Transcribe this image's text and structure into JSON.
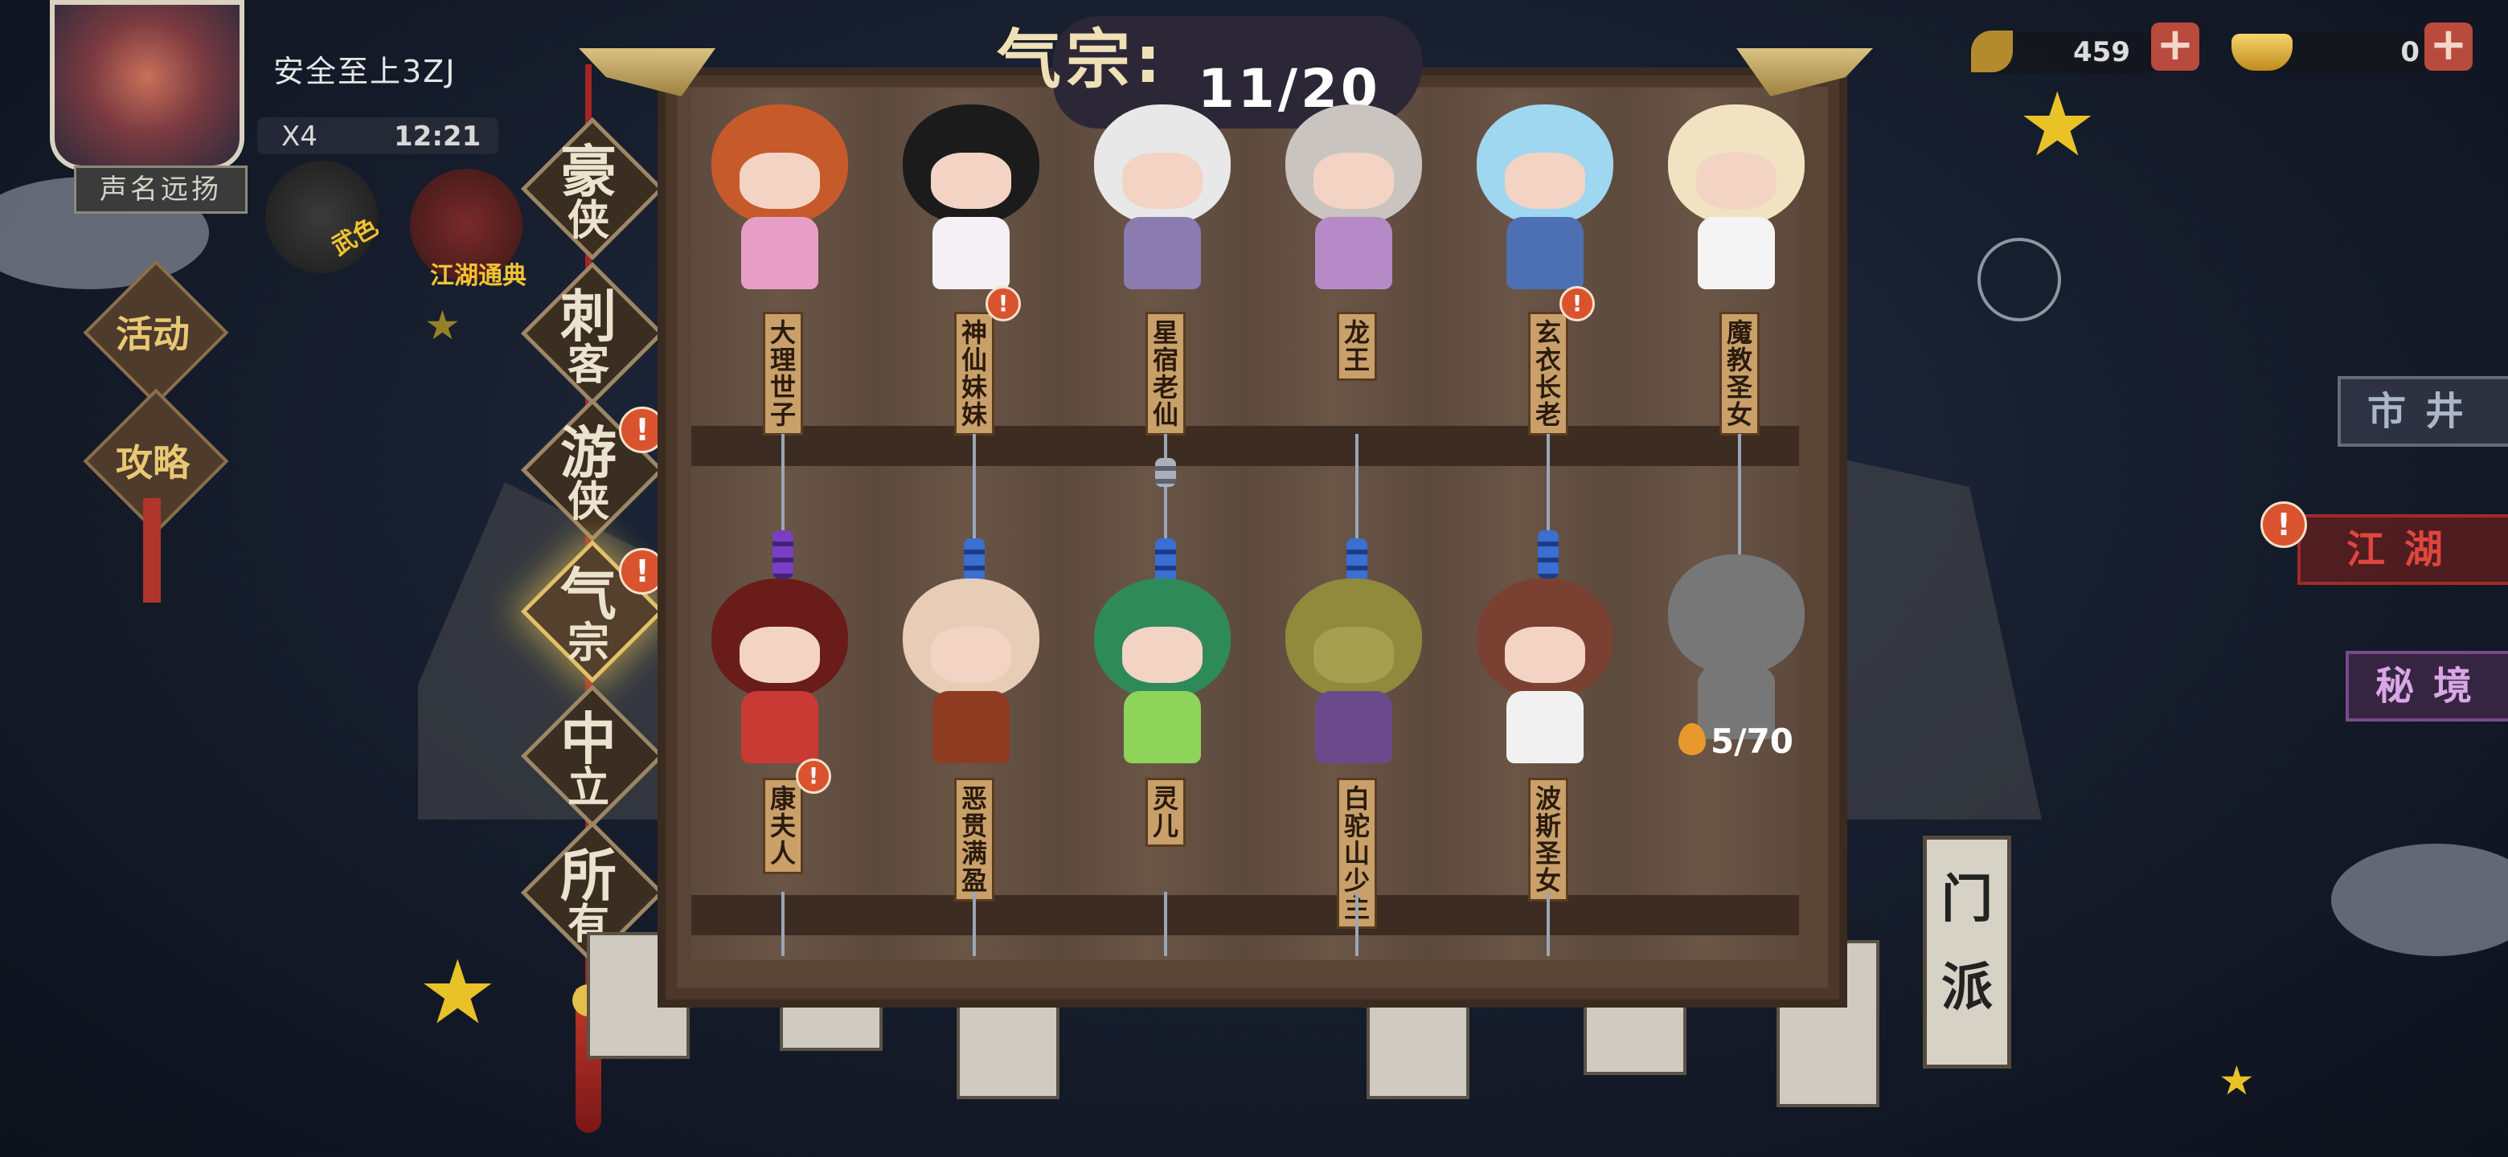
{
  "player": {
    "name": "安全至上3ZJ",
    "multiplier": "X4",
    "time": "12:21",
    "fame_button": "声名远扬"
  },
  "left_items": {
    "codex_label": "江湖通典",
    "event_label": "活动",
    "guide_label": "攻略",
    "skin_label": "武色"
  },
  "currencies": [
    {
      "icon": "leaf-icon",
      "value": "459"
    },
    {
      "icon": "gold-ingot-icon",
      "value": "0"
    }
  ],
  "right_menu": [
    {
      "label": "市井",
      "color": "#a9b7c9",
      "alert": false
    },
    {
      "label": "江湖",
      "color": "#e0463f",
      "alert": true
    },
    {
      "label": "秘境",
      "color": "#d9a6e6",
      "alert": false
    }
  ],
  "categories": [
    {
      "line1": "豪",
      "line2": "侠",
      "alert": false,
      "active": false
    },
    {
      "line1": "刺",
      "line2": "客",
      "alert": false,
      "active": false
    },
    {
      "line1": "游",
      "line2": "侠",
      "alert": true,
      "active": false
    },
    {
      "line1": "气",
      "line2": "宗",
      "alert": true,
      "active": true
    },
    {
      "line1": "中",
      "line2": "立",
      "alert": false,
      "active": false
    },
    {
      "line1": "所",
      "line2": "有",
      "alert": false,
      "active": false
    }
  ],
  "title": {
    "label": "气宗:",
    "count": "11/20"
  },
  "characters_row1": [
    {
      "name": "大理世子",
      "alert": false,
      "hair": "#c65a2a",
      "outfit": "#e79fc8"
    },
    {
      "name": "神仙妹妹",
      "alert": true,
      "hair": "#1b1b1b",
      "outfit": "#f4f0f4"
    },
    {
      "name": "星宿老仙",
      "alert": false,
      "hair": "#e8e8e8",
      "outfit": "#8a7bb0"
    },
    {
      "name": "龙王",
      "alert": false,
      "hair": "#c9c4bf",
      "outfit": "#b68ac7"
    },
    {
      "name": "玄衣长老",
      "alert": true,
      "hair": "#9fd6f0",
      "outfit": "#4d6fb3"
    },
    {
      "name": "魔教圣女",
      "alert": false,
      "hair": "#f1e2c2",
      "outfit": "#f4f4f4"
    }
  ],
  "characters_row2": [
    {
      "name": "康夫人",
      "alert": true,
      "hair": "#6a1c1a",
      "outfit": "#c93a34",
      "locked": false
    },
    {
      "name": "恶贯满盈",
      "alert": false,
      "hair": "#e7cdb5",
      "outfit": "#8f3b22",
      "locked": false
    },
    {
      "name": "灵儿",
      "alert": false,
      "hair": "#2f8a5a",
      "outfit": "#8ed35a",
      "locked": false
    },
    {
      "name": "白驼山少主",
      "alert": false,
      "hair": "#8f8a3c",
      "outfit": "#6b4a8c",
      "locked": false
    },
    {
      "name": "波斯圣女",
      "alert": false,
      "hair": "#7a4032",
      "outfit": "#f1f1f1",
      "locked": false
    },
    {
      "name": "",
      "alert": false,
      "hair": "#7b7b7b",
      "outfit": "#7b7b7b",
      "locked": true,
      "shards": "5/70"
    }
  ],
  "bottom_plaques": [
    "门",
    "派"
  ]
}
